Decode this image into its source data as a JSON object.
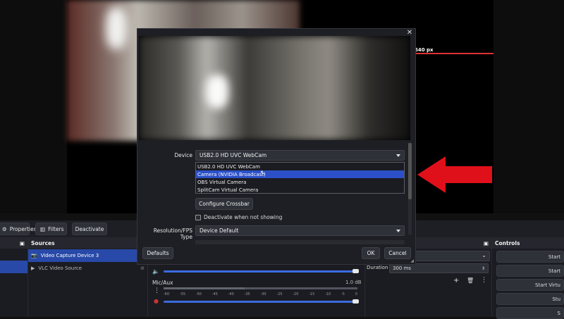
{
  "preview": {
    "resolution_label": "640 px"
  },
  "toolbar": {
    "properties_label": "Properties",
    "filters_label": "Filters",
    "deactivate_label": "Deactivate"
  },
  "sources": {
    "title": "Sources",
    "items": [
      {
        "label": "Video Capture Device 3",
        "selected": true
      },
      {
        "label": "VLC Video Source",
        "selected": false
      }
    ]
  },
  "mixer": {
    "channel_name": "Mic/Aux",
    "channel_db": "1.0 dB",
    "tick_labels": [
      "-60",
      "-55",
      "-50",
      "-45",
      "-40",
      "-35",
      "-30",
      "-25",
      "-20",
      "-15",
      "-10",
      "-5",
      "0"
    ]
  },
  "transitions": {
    "duration_label": "Duration",
    "duration_value": "300 ms"
  },
  "controls": {
    "title": "Controls",
    "buttons": [
      "Start",
      "Start",
      "Start Virtu",
      "Stu",
      "S"
    ]
  },
  "dialog": {
    "device_label": "Device",
    "device_value": "USB2.0 HD UVC WebCam",
    "device_options": [
      "USB2.0 HD UVC WebCam",
      "Camera (NVIDIA Broadcast)",
      "OBS Virtual Camera",
      "SplitCam Virtual Camera"
    ],
    "highlighted_option": "Camera (NVIDIA Broadcast)",
    "configure_crossbar_label": "Configure Crossbar",
    "deactivate_checkbox_label": "Deactivate when not showing",
    "resolution_label": "Resolution/FPS Type",
    "resolution_value": "Device Default",
    "defaults_label": "Defaults",
    "ok_label": "OK",
    "cancel_label": "Cancel",
    "close_glyph": "✕"
  },
  "colors": {
    "accent": "#2849a8",
    "highlight": "#2b50c8",
    "arrow": "#e0101a"
  }
}
